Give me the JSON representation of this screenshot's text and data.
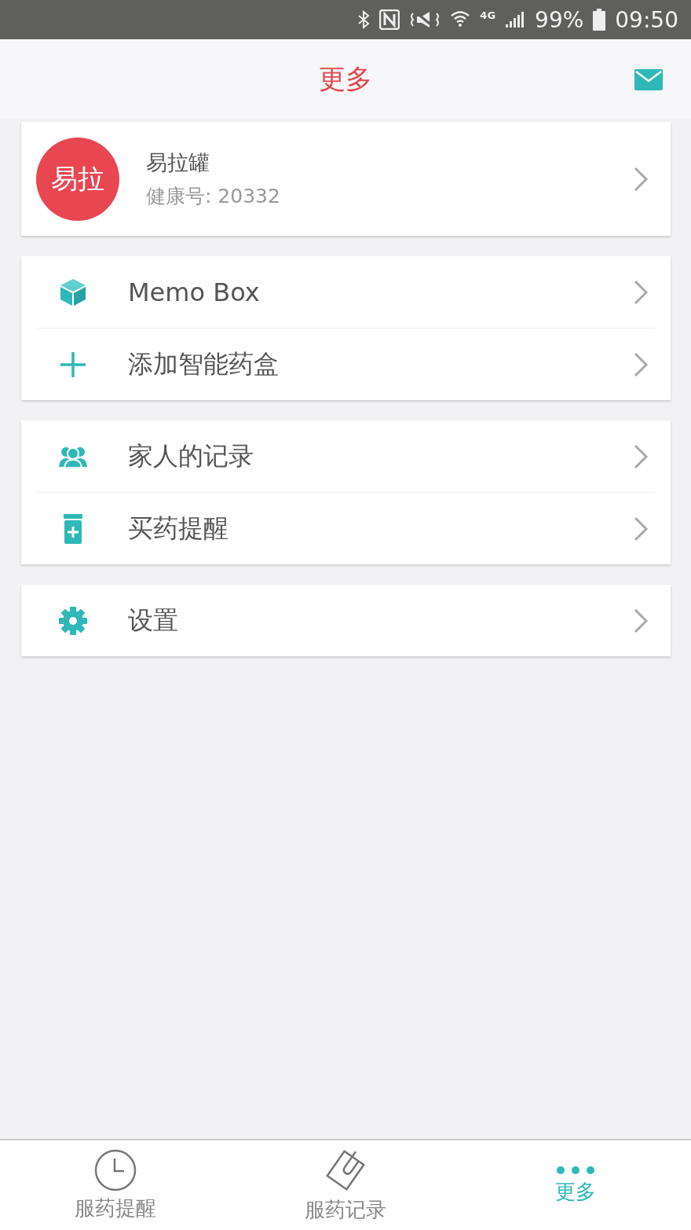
{
  "status_bar": {
    "battery": "99%",
    "network": "4G",
    "time": "09:50"
  },
  "header": {
    "title": "更多"
  },
  "profile": {
    "avatar_text": "易拉",
    "name": "易拉罐",
    "health_id": "健康号: 20332"
  },
  "groups": [
    {
      "items": [
        {
          "kind": "cube",
          "label": "Memo Box"
        },
        {
          "kind": "plus",
          "label": "添加智能药盒"
        }
      ]
    },
    {
      "items": [
        {
          "kind": "people",
          "label": "家人的记录"
        },
        {
          "kind": "bottle",
          "label": "买药提醒"
        }
      ]
    },
    {
      "items": [
        {
          "kind": "gear",
          "label": "设置"
        }
      ]
    }
  ],
  "tabs": [
    {
      "kind": "clock",
      "label": "服药提醒",
      "selected": false
    },
    {
      "kind": "clip",
      "label": "服药记录",
      "selected": false
    },
    {
      "kind": "dots",
      "label": "更多",
      "selected": true
    }
  ]
}
